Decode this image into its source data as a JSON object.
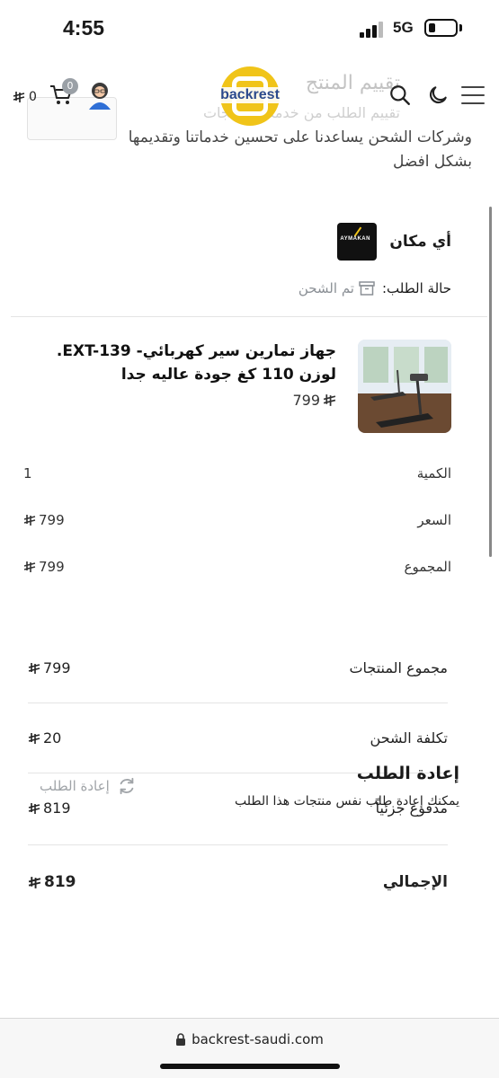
{
  "status_bar": {
    "time": "4:55",
    "network": "5G"
  },
  "header": {
    "logo_text": "backrest",
    "cart_count": "0",
    "cart_total": "0",
    "ghost_title": "تقييم المنتج",
    "ghost_subtitle": "تقييم الطلب من خدمة والمنتجات"
  },
  "peek_text": "وشركات الشحن يساعدنا على تحسين خدماتنا وتقديمها بشكل افضل",
  "order": {
    "carrier_name": "أي مكان",
    "carrier_logo_text": "AYMAKAN",
    "status_label": "حالة الطلب:",
    "status_value": "تم الشحن",
    "product": {
      "name": "جهاز تمارين سير كهربائي- EXT-139. لوزن 110 كغ جودة عاليه جدا",
      "price": "799"
    },
    "details": [
      {
        "label": "الكمية",
        "value": "1",
        "currency": false
      },
      {
        "label": "السعر",
        "value": "799",
        "currency": true
      },
      {
        "label": "المجموع",
        "value": "799",
        "currency": true
      }
    ],
    "summary": [
      {
        "label": "مجموع المنتجات",
        "value": "799"
      },
      {
        "label": "تكلفة الشحن",
        "value": "20"
      },
      {
        "label": "مدفوع جزئياً",
        "value": "819"
      },
      {
        "label": "الإجمالي",
        "value": "819"
      }
    ]
  },
  "reorder": {
    "title": "إعادة الطلب",
    "description": "يمكنك إعادة طلب نفس منتجات هذا الطلب",
    "button_label": "إعادة الطلب"
  },
  "browser": {
    "url": "backrest-saudi.com"
  },
  "colors": {
    "brand_yellow": "#f0c419",
    "brand_blue": "#2b4a8c",
    "muted": "#8a8f95"
  }
}
